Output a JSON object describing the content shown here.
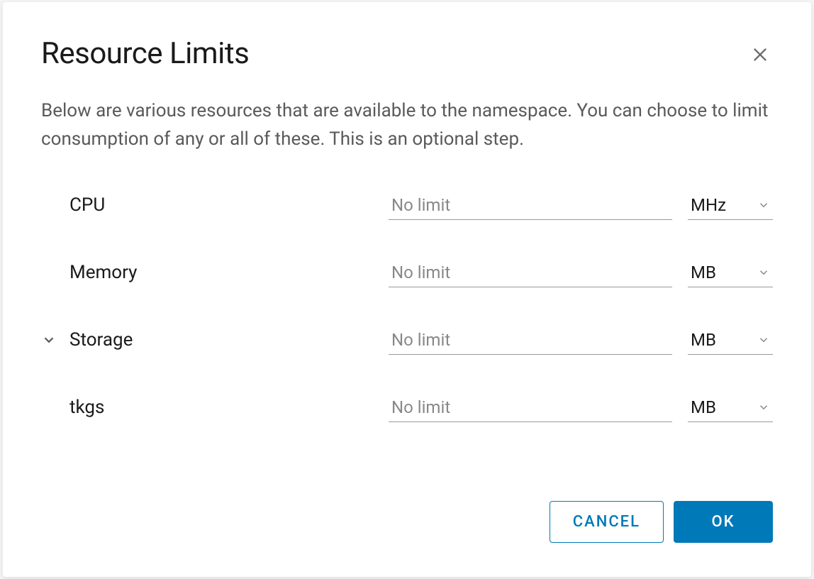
{
  "dialog": {
    "title": "Resource Limits",
    "description": "Below are various resources that are available to the namespace. You can choose to limit consumption of any or all of these. This is an optional step.",
    "rows": [
      {
        "label": "CPU",
        "placeholder": "No limit",
        "unit": "MHz",
        "expandable": false
      },
      {
        "label": "Memory",
        "placeholder": "No limit",
        "unit": "MB",
        "expandable": false
      },
      {
        "label": "Storage",
        "placeholder": "No limit",
        "unit": "MB",
        "expandable": true
      },
      {
        "label": "tkgs",
        "placeholder": "No limit",
        "unit": "MB",
        "expandable": false
      }
    ],
    "buttons": {
      "cancel": "CANCEL",
      "ok": "OK"
    }
  }
}
